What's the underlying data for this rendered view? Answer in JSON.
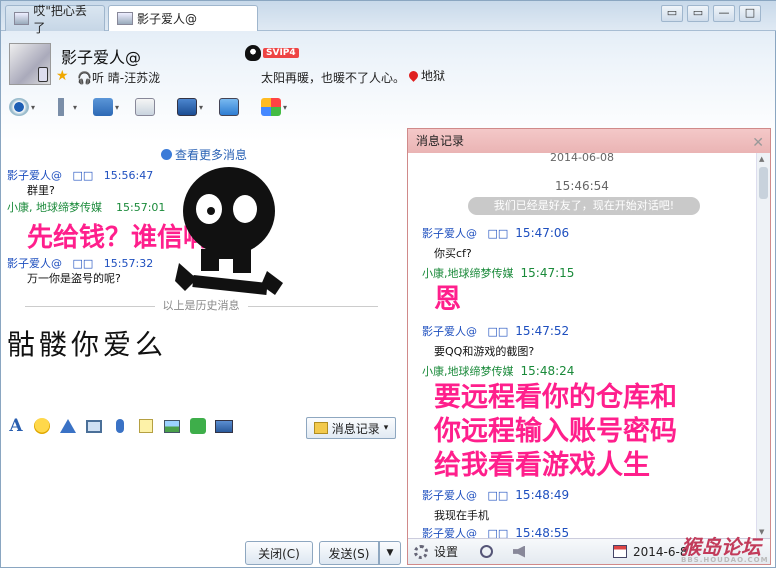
{
  "tabs": [
    {
      "label": "哎\"把心丢了"
    },
    {
      "label": "影子爱人@"
    }
  ],
  "window_controls": {
    "a": "▭",
    "b": "▭",
    "min": "—",
    "max": "□",
    "close": "✕"
  },
  "header": {
    "name": "影子爱人@",
    "vip": "SVIP4",
    "music": "听 晴-汪苏泷",
    "signature": "太阳再暖，也暖不了人心。",
    "location": "地狱"
  },
  "chat": {
    "more_link": "查看更多消息",
    "messages": [
      {
        "sender": "影子爱人@",
        "badge": "□□",
        "time": "15:56:47",
        "text": "群里?"
      },
      {
        "sender": "小康, 地球缔梦传媒",
        "time": "15:57:01",
        "text": ""
      },
      {
        "sender": "影子爱人@",
        "badge": "□□",
        "time": "15:57:32",
        "text": "万一你是盗号的呢?"
      }
    ],
    "overlay_text": "先给钱？谁信啊",
    "history_divider": "以上是历史消息",
    "typed_text": "骷髅你爱么"
  },
  "format_bar": {
    "font": "A",
    "history_button": "消息记录",
    "history_dd": "▾"
  },
  "buttons": {
    "close": "关闭(C)",
    "send": "发送(S)",
    "send_dd": "▼"
  },
  "panel": {
    "title": "消息记录",
    "close": "✕",
    "date_header": "2014-06-08",
    "time_stamp": "15:46:54",
    "notice": "我们已经是好友了，现在开始对话吧!",
    "entries": [
      {
        "sender": "影子爱人@",
        "badge": "□□",
        "time": "15:47:06",
        "text": "你买cf?"
      },
      {
        "sender": "小康,地球缔梦传媒",
        "time": "15:47:15",
        "big": "恩"
      },
      {
        "sender": "影子爱人@",
        "badge": "□□",
        "time": "15:47:52",
        "text": "要QQ和游戏的截图?"
      },
      {
        "sender": "小康,地球缔梦传媒",
        "time": "15:48:24",
        "big1": "要远程看你的仓库和",
        "big2": "你远程输入账号密码",
        "big3": "给我看看游戏人生"
      },
      {
        "sender": "影子爱人@",
        "badge": "□□",
        "time": "15:48:49",
        "text": "我现在手机"
      },
      {
        "sender": "影子爱人@",
        "badge": "□□",
        "time": "15:48:55",
        "text": ""
      }
    ],
    "footer": {
      "settings": "设置",
      "date": "2014-6-8"
    }
  },
  "watermark": {
    "main": "猴岛论坛",
    "sub": "BBS.HOUDAO.COM"
  }
}
